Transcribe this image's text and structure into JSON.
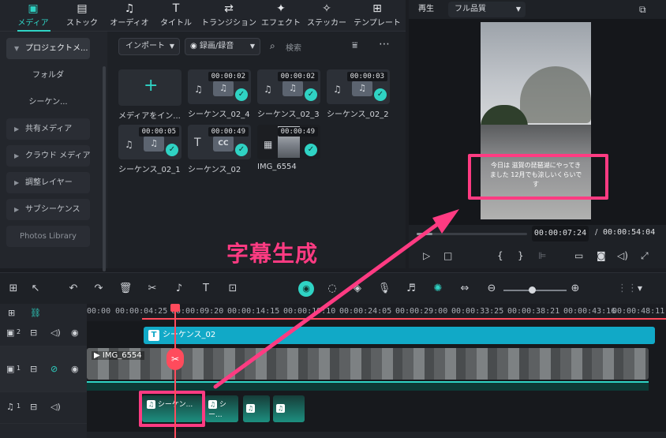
{
  "toolbar": {
    "tabs": [
      {
        "label": "メディア",
        "icon": "media-folder-icon"
      },
      {
        "label": "ストック",
        "icon": "stock-icon"
      },
      {
        "label": "オーディオ",
        "icon": "music-note-icon"
      },
      {
        "label": "タイトル",
        "icon": "text-t-icon"
      },
      {
        "label": "トランジション",
        "icon": "transition-icon"
      },
      {
        "label": "エフェクト",
        "icon": "effects-icon"
      },
      {
        "label": "ステッカー",
        "icon": "sticker-icon"
      },
      {
        "label": "テンプレート",
        "icon": "template-icon"
      }
    ],
    "active_tab": "メディア"
  },
  "sidebar": {
    "items": [
      {
        "label": "プロジェクトメ..."
      },
      {
        "label": "フォルダ"
      },
      {
        "label": "シーケン..."
      },
      {
        "label": "共有メディア"
      },
      {
        "label": "クラウド メディア"
      },
      {
        "label": "調整レイヤー"
      },
      {
        "label": "サブシーケンス"
      },
      {
        "label": "Photos Library"
      }
    ]
  },
  "media": {
    "import_label": "インポート",
    "record_label": "録画/録音",
    "search_placeholder": "検索",
    "items": [
      {
        "name": "メディアをイン...",
        "duration": ""
      },
      {
        "name": "シーケンス_02_4",
        "duration": "00:00:02"
      },
      {
        "name": "シーケンス_02_3",
        "duration": "00:00:02"
      },
      {
        "name": "シーケンス_02_2",
        "duration": "00:00:03"
      },
      {
        "name": "シーケンス_02_1",
        "duration": "00:00:05"
      },
      {
        "name": "シーケンス_02",
        "duration": "00:00:49"
      },
      {
        "name": "IMG_6554",
        "duration": "00:00:49"
      }
    ]
  },
  "preview": {
    "play_label": "再生",
    "quality": "フル品質",
    "subtitle": "今日は 滋賀の琵琶湖にやってきました 12月でも涼しいくらいです",
    "current_time": "00:00:07:24",
    "separator": "/",
    "total_time": "00:00:54:04",
    "progress": 0.146
  },
  "timeline": {
    "ruler": [
      "00:00",
      "00:00:04:25",
      "00:00:09:20",
      "00:00:14:15",
      "00:00:19:10",
      "00:00:24:05",
      "00:00:29:00",
      "00:00:33:25",
      "00:00:38:21",
      "00:00:43:16",
      "00:00:48:11"
    ],
    "title_clip": "シーケンス_02",
    "video_clip": "IMG_6554",
    "audio_clips": [
      "シーケン...",
      "シー..."
    ],
    "track_labels": [
      "2",
      "1",
      "1"
    ]
  },
  "annotation": "字幕生成",
  "colors": {
    "accent": "#2fd3c4",
    "title_track": "#11a9c7",
    "highlight": "#ff3b82",
    "playhead": "#ff4b5c"
  }
}
